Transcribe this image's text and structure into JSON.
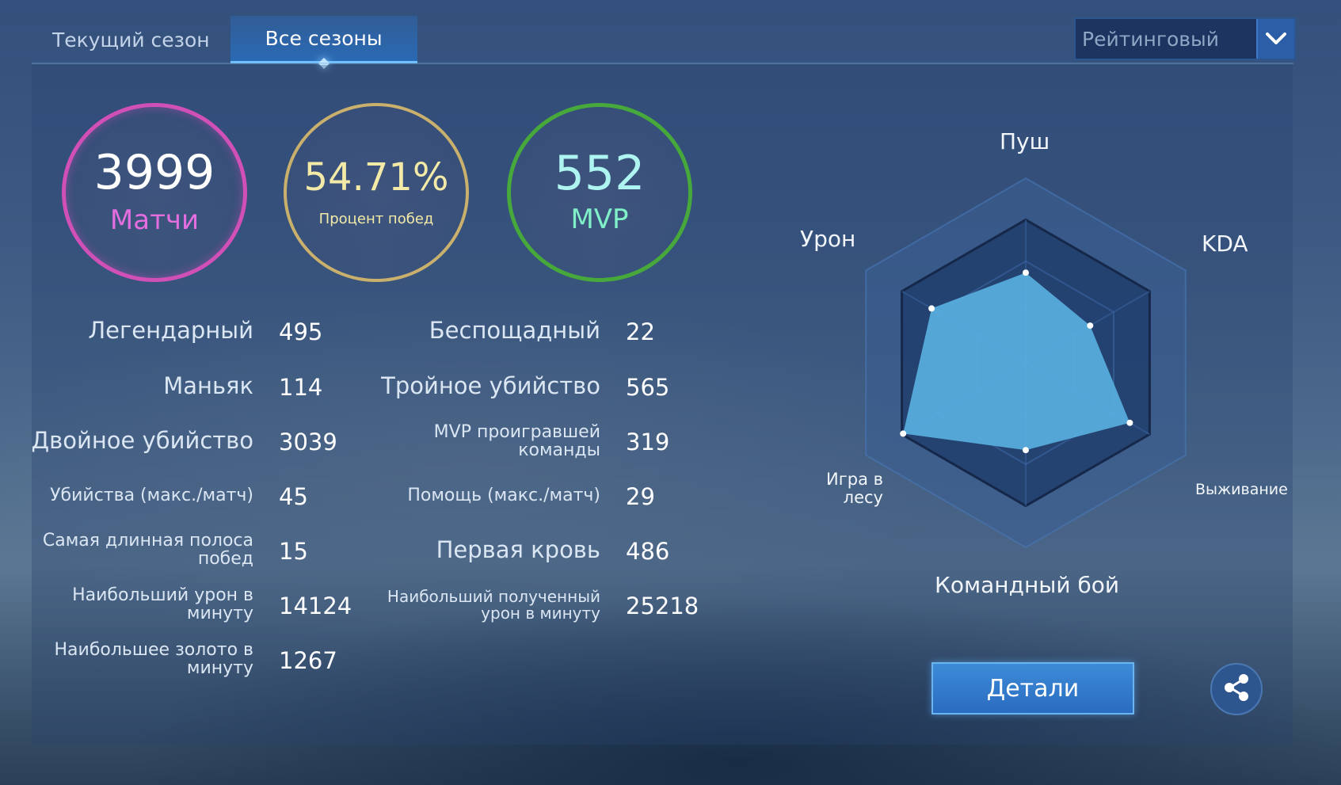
{
  "tabs": [
    {
      "label": "Текущий сезон",
      "active": false
    },
    {
      "label": "Все сезоны",
      "active": true
    }
  ],
  "mode_select": {
    "value": "Рейтинговый",
    "icon": "chevron-down-icon"
  },
  "summary": {
    "matches": {
      "value": "3999",
      "label": "Матчи"
    },
    "win_rate": {
      "value": "54.71%",
      "label": "Процент побед"
    },
    "mvp": {
      "value": "552",
      "label": "MVP"
    }
  },
  "stats_left": [
    {
      "label": "Легендарный",
      "value": "495"
    },
    {
      "label": "Маньяк",
      "value": "114"
    },
    {
      "label": "Двойное убийство",
      "value": "3039"
    },
    {
      "label": "Убийства (макс./матч)",
      "value": "45"
    },
    {
      "label": "Самая длинная полоса побед",
      "value": "15"
    },
    {
      "label": "Наибольший урон в минуту",
      "value": "14124"
    },
    {
      "label": "Наибольшее золото в минуту",
      "value": "1267"
    }
  ],
  "stats_right": [
    {
      "label": "Беспощадный",
      "value": "22"
    },
    {
      "label": "Тройное убийство",
      "value": "565"
    },
    {
      "label": "MVP проигравшей команды",
      "value": "319"
    },
    {
      "label": "Помощь (макс./матч)",
      "value": "29"
    },
    {
      "label": "Первая кровь",
      "value": "486"
    },
    {
      "label": "Наибольший полученный урон в минуту",
      "value": "25218"
    }
  ],
  "radar": {
    "labels": {
      "push": "Пуш",
      "kda": "KDA",
      "survival": "Выживание",
      "teamfight": "Командный бой",
      "jungle": "Игра в лесу",
      "damage": "Урон"
    },
    "values": {
      "push": 0.63,
      "kda": 0.52,
      "survival": 0.84,
      "teamfight": 0.61,
      "jungle": 0.99,
      "damage": 0.76
    },
    "colors": {
      "fill": "#5cb7e6",
      "outer": "#3b5f93",
      "inner": "#213e6c"
    }
  },
  "buttons": {
    "details": "Детали",
    "share_icon": "share-icon"
  },
  "colors": {
    "matches": "#d150b8",
    "win_rate": "#c9b06c",
    "mvp": "#47a83b",
    "accent": "#2c5ea8"
  }
}
